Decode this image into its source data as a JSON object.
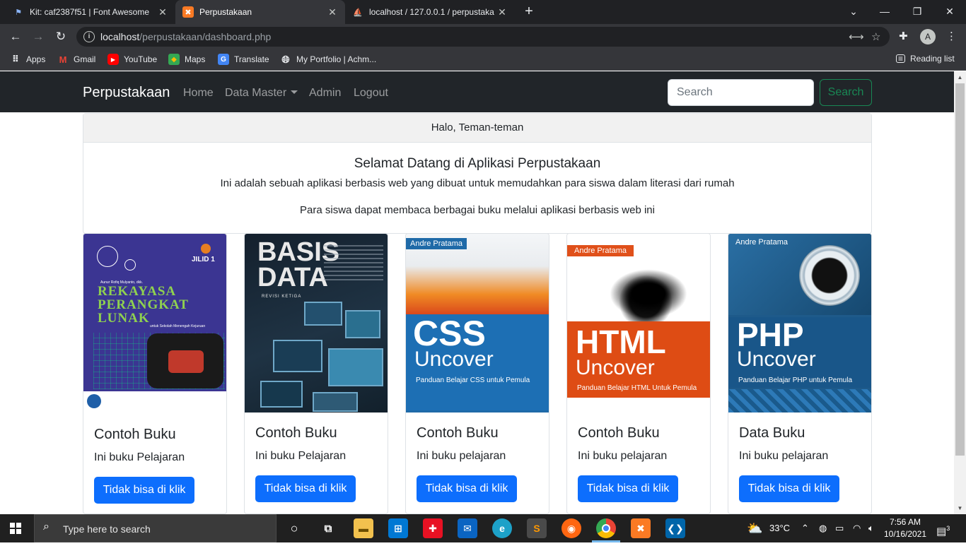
{
  "browser": {
    "tabs": [
      {
        "title": "Kit: caf2387f51 | Font Awesome",
        "icon": "flag-icon",
        "active": false
      },
      {
        "title": "Perpustakaan",
        "icon": "xampp-icon",
        "active": true
      },
      {
        "title": "localhost / 127.0.0.1 / perpustaka",
        "icon": "phpmyadmin-icon",
        "active": false
      }
    ],
    "new_tab": "+",
    "url_host": "localhost",
    "url_path": "/perpustakaan/dashboard.php",
    "profile_initial": "A",
    "bookmarks": [
      {
        "label": "Apps",
        "icon": "apps-grid-icon"
      },
      {
        "label": "Gmail",
        "icon": "gmail-icon"
      },
      {
        "label": "YouTube",
        "icon": "youtube-icon"
      },
      {
        "label": "Maps",
        "icon": "maps-icon"
      },
      {
        "label": "Translate",
        "icon": "translate-icon"
      },
      {
        "label": "My Portfolio | Achm...",
        "icon": "globe-icon"
      }
    ],
    "reading_list": "Reading list"
  },
  "navbar": {
    "brand": "Perpustakaan",
    "links": [
      "Home",
      "Data Master",
      "Admin",
      "Logout"
    ],
    "search_placeholder": "Search",
    "search_button": "Search"
  },
  "welcome": {
    "header": "Halo, Teman-teman",
    "title": "Selamat Datang di Aplikasi Perpustakaan",
    "line1": "Ini adalah sebuah aplikasi berbasis web yang dibuat untuk memudahkan para siswa dalam literasi dari rumah",
    "line2": "Para siswa dapat membaca berbagai buku melalui aplikasi berbasis web ini"
  },
  "books": [
    {
      "title": "Contoh Buku",
      "text": "Ini buku Pelajaran",
      "button": "Tidak bisa di klik",
      "cover": {
        "author": "Aunur Rofiq Mulyanto, dkk.",
        "volume": "JILID 1",
        "lines": [
          "REKAYASA",
          "PERANGKAT",
          "LUNAK"
        ],
        "sub": "untuk Sekolah Menengah Kejuruan"
      }
    },
    {
      "title": "Contoh Buku",
      "text": "Ini buku Pelajaran",
      "button": "Tidak bisa di klik",
      "cover": {
        "lines": [
          "BASIS",
          "DATA"
        ],
        "sub": "REVISI KETIGA"
      }
    },
    {
      "title": "Contoh Buku",
      "text": "Ini buku pelajaran",
      "button": "Tidak bisa di klik",
      "cover": {
        "author": "Andre Pratama",
        "lines": [
          "CSS",
          "Uncover"
        ],
        "sub": "Panduan Belajar CSS untuk Pemula"
      }
    },
    {
      "title": "Contoh Buku",
      "text": "Ini buku pelajaran",
      "button": "Tidak bisa di klik",
      "cover": {
        "author": "Andre Pratama",
        "lines": [
          "HTML",
          "Uncover"
        ],
        "sub": "Panduan Belajar HTML Untuk Pemula"
      }
    },
    {
      "title": "Data Buku",
      "text": "Ini buku pelajaran",
      "button": "Tidak bisa di klik",
      "cover": {
        "author": "Andre Pratama",
        "lines": [
          "PHP",
          "Uncover"
        ],
        "sub": "Panduan Belajar PHP untuk Pemula"
      }
    }
  ],
  "taskbar": {
    "search_placeholder": "Type here to search",
    "weather": "33°C",
    "time": "7:56 AM",
    "date": "10/16/2021",
    "notifications": "3"
  }
}
